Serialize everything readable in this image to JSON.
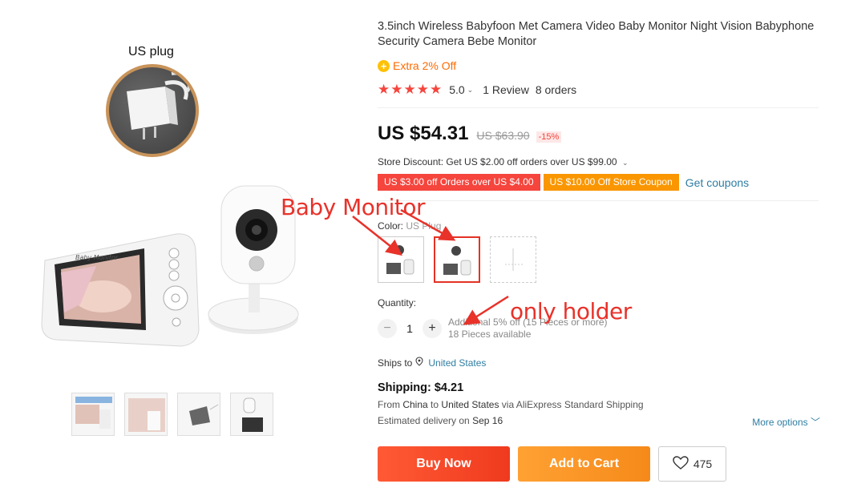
{
  "gallery": {
    "plug_caption": "US plug",
    "device_label": "Baby Monitor",
    "thumbnails": [
      "thumb-1",
      "thumb-2",
      "thumb-3",
      "thumb-4"
    ]
  },
  "product": {
    "title": "3.5inch Wireless Babyfoon Met Camera Video Baby Monitor Night Vision Babyphone Security Camera Bebe Monitor",
    "extra_off": "Extra 2% Off",
    "stars": "★★★★★",
    "rating": "5.0",
    "reviews": "1 Review",
    "orders": "8 orders"
  },
  "price": {
    "current": "US $54.31",
    "original": "US $63.90",
    "discount": "-15%"
  },
  "store": {
    "discount_text": "Store Discount: Get US $2.00 off orders over US $99.00",
    "coupon_1": "US $3.00 off Orders over US $4.00",
    "coupon_2": "US $10.00 Off Store Coupon",
    "get_coupons": "Get coupons"
  },
  "color": {
    "label": "Color:",
    "value": "US Plug"
  },
  "quantity": {
    "label": "Quantity:",
    "value": "1",
    "minus": "−",
    "plus": "+",
    "note_1": "Additional 5% off (15 Pieces or more)",
    "note_2": "18 Pieces available"
  },
  "shipping": {
    "ships_to_label": "Ships to",
    "country": "United States",
    "cost": "Shipping: $4.21",
    "from_prefix": "From",
    "from_country": "China",
    "to_word": "to",
    "to_country": "United States",
    "via": "via AliExpress Standard Shipping",
    "delivery_prefix": "Estimated delivery on",
    "delivery_date": "Sep 16",
    "more_options": "More options"
  },
  "actions": {
    "buy_now": "Buy Now",
    "add_to_cart": "Add to Cart",
    "wishlist_count": "475"
  },
  "annotations": {
    "baby_monitor": "Baby Monitor",
    "only_holder": "only holder"
  },
  "colors": {
    "accent_red": "#f5453d",
    "accent_orange": "#fa9600",
    "link_blue": "#2e7da2"
  }
}
